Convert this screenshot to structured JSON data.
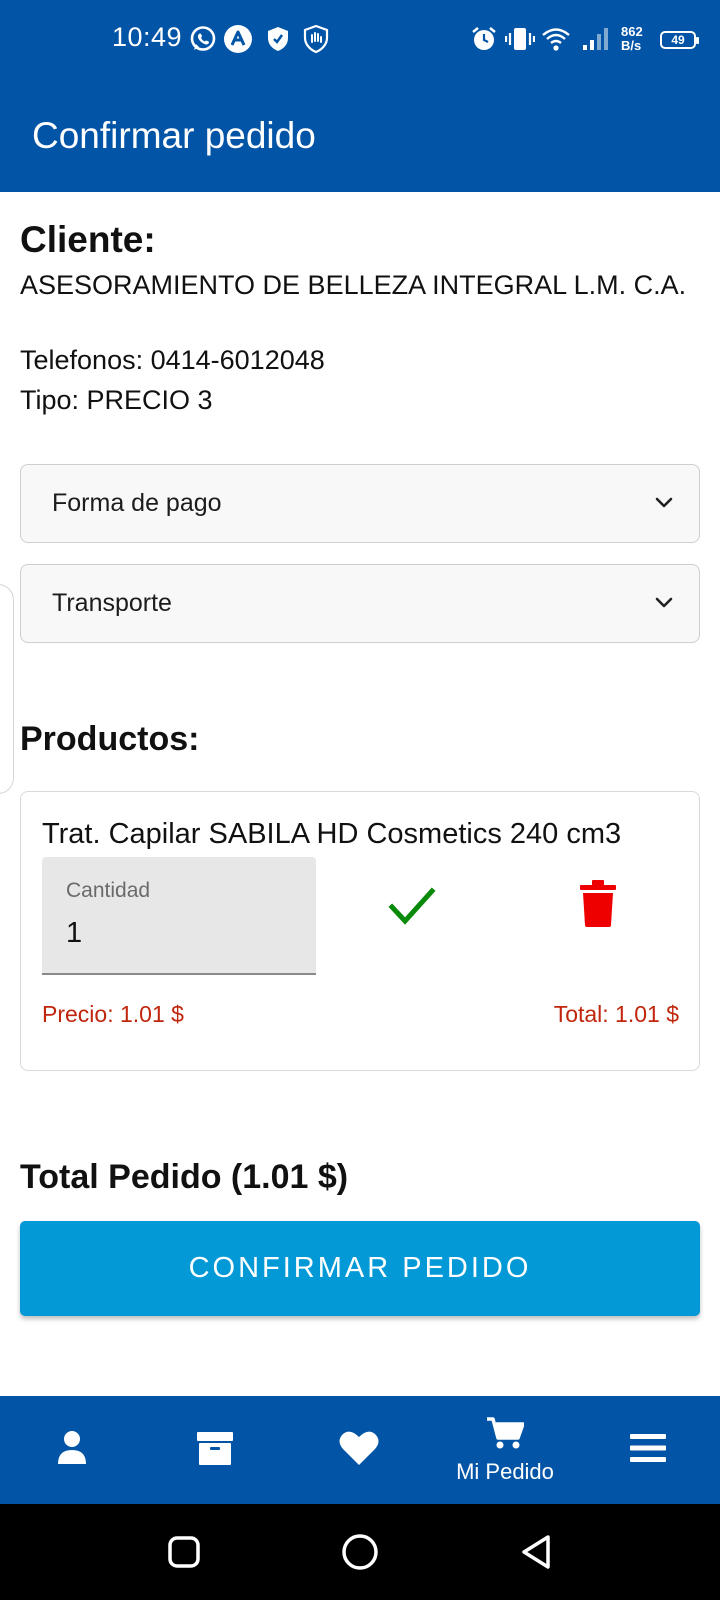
{
  "status_bar": {
    "time": "10:49",
    "net_speed_value": "862",
    "net_speed_unit": "B/s",
    "battery": "49",
    "icons": [
      "whatsapp-icon",
      "app-a-icon",
      "shield-icon",
      "hand-shield-icon",
      "alarm-icon",
      "vibrate-icon",
      "wifi-icon",
      "signal-icon",
      "battery-icon"
    ]
  },
  "app_bar": {
    "title": "Confirmar pedido"
  },
  "client": {
    "heading": "Cliente:",
    "name": "ASESORAMIENTO DE BELLEZA INTEGRAL L.M. C.A.",
    "phones": "Telefonos: 0414-6012048",
    "type": "Tipo: PRECIO 3"
  },
  "selects": {
    "payment": {
      "label": "Forma de pago",
      "icon": "chevron-down-icon"
    },
    "transport": {
      "label": "Transporte",
      "icon": "chevron-down-icon"
    }
  },
  "products": {
    "heading": "Productos:",
    "items": [
      {
        "name": "Trat. Capilar SABILA HD Cosmetics 240 cm3",
        "quantity_label": "Cantidad",
        "quantity": "1",
        "price": "Precio: 1.01 $",
        "total": "Total: 1.01 $"
      }
    ]
  },
  "order": {
    "total": "Total Pedido (1.01 $)",
    "confirm_label": "CONFIRMAR PEDIDO"
  },
  "bottom_nav": {
    "items": [
      {
        "icon": "user-icon",
        "label": ""
      },
      {
        "icon": "archive-icon",
        "label": ""
      },
      {
        "icon": "heart-icon",
        "label": ""
      },
      {
        "icon": "cart-icon",
        "label": "Mi Pedido"
      },
      {
        "icon": "menu-icon",
        "label": ""
      }
    ]
  },
  "colors": {
    "primary": "#0254a6",
    "button": "#0299d6",
    "price": "#c0260c",
    "confirm_check": "#0a8a0a",
    "delete": "#ee0000"
  }
}
